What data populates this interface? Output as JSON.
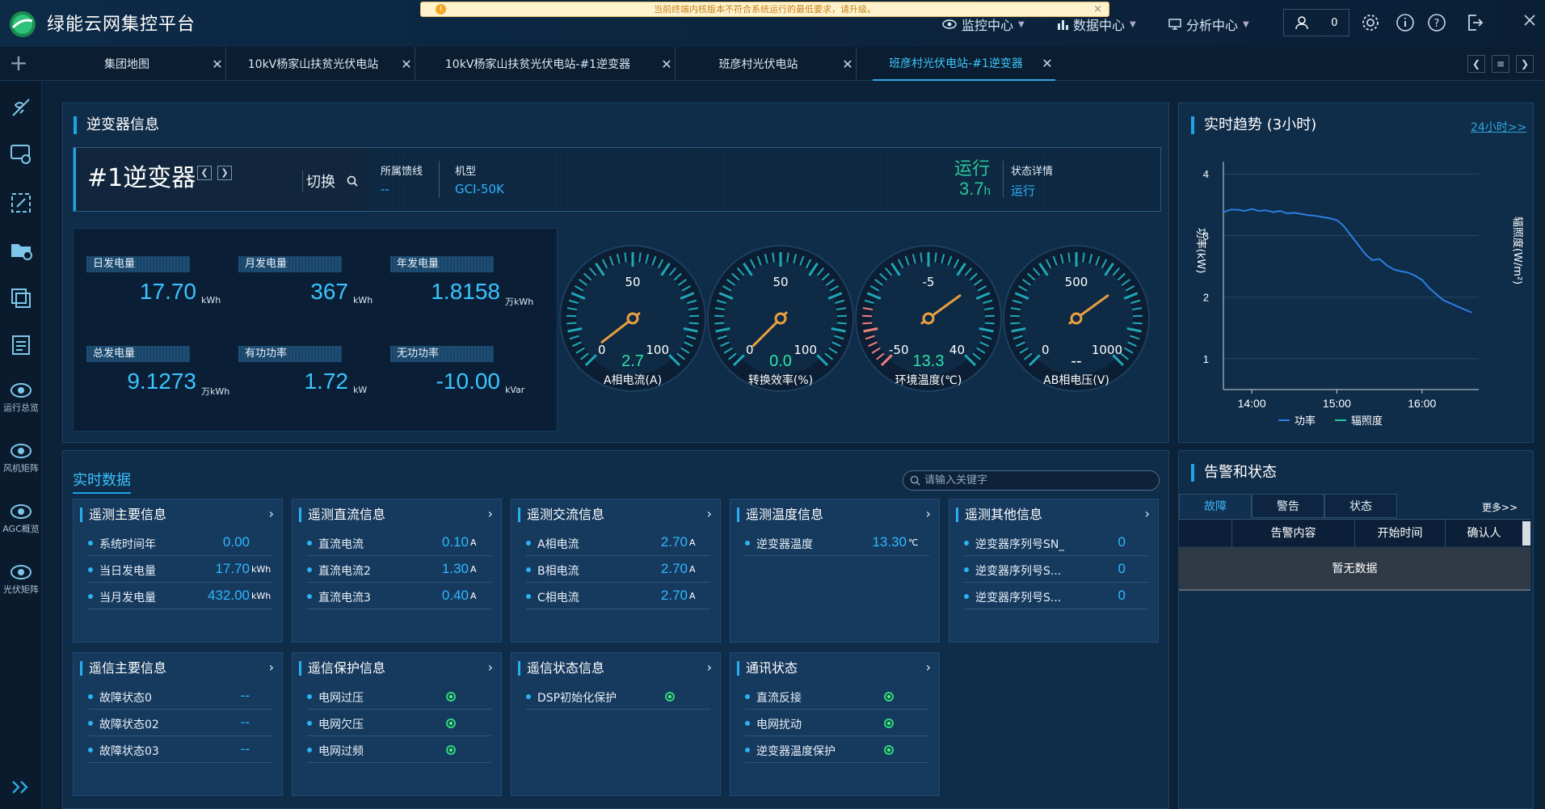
{
  "app": {
    "title": "绿能云网集控平台"
  },
  "notice": {
    "text": "当前终端内核版本不符合系统运行的最低要求，请升级。"
  },
  "topnav": [
    {
      "label": "监控中心",
      "icon": "eye-icon"
    },
    {
      "label": "数据中心",
      "icon": "bar-chart-icon"
    },
    {
      "label": "分析中心",
      "icon": "monitor-chart-icon"
    }
  ],
  "user": {
    "count": "0"
  },
  "tabs": [
    {
      "label": "集团地图"
    },
    {
      "label": "10kV杨家山扶贫光伏电站"
    },
    {
      "label": "10kV杨家山扶贫光伏电站-#1逆变器"
    },
    {
      "label": "班彦村光伏电站"
    },
    {
      "label": "班彦村光伏电站-#1逆变器"
    }
  ],
  "sidebar": [
    {
      "icon": "satellite-icon",
      "label": ""
    },
    {
      "icon": "monitor-refresh-icon",
      "label": ""
    },
    {
      "icon": "edit-frame-icon",
      "label": ""
    },
    {
      "icon": "folder-add-icon",
      "label": ""
    },
    {
      "icon": "layers-icon",
      "label": ""
    },
    {
      "icon": "list-doc-icon",
      "label": ""
    },
    {
      "icon": "eye-icon",
      "label": "运行总览"
    },
    {
      "icon": "eye-icon",
      "label": "风机矩阵"
    },
    {
      "icon": "eye-icon",
      "label": "AGC概览"
    },
    {
      "icon": "eye-icon",
      "label": "光伏矩阵"
    }
  ],
  "inverter": {
    "section_title": "逆变器信息",
    "name": "#1逆变器",
    "switch_label": "切换",
    "feeder_label": "所属馈线",
    "feeder_value": "--",
    "model_label": "机型",
    "model_value": "GCI-50K",
    "run_state": "运行",
    "run_hours_value": "3.7",
    "run_hours_unit": "h",
    "status_label": "状态详情",
    "status_value": "运行"
  },
  "stats": [
    {
      "label": "日发电量",
      "value": "17.70",
      "unit": "kWh"
    },
    {
      "label": "月发电量",
      "value": "367",
      "unit": "kWh"
    },
    {
      "label": "年发电量",
      "value": "1.8158",
      "unit": "万kWh"
    },
    {
      "label": "总发电量",
      "value": "9.1273",
      "unit": "万kWh"
    },
    {
      "label": "有功功率",
      "value": "1.72",
      "unit": "kW"
    },
    {
      "label": "无功功率",
      "value": "-10.00",
      "unit": "kVar"
    }
  ],
  "gauges": [
    {
      "name": "A相电流(A)",
      "min": "0",
      "max": "100",
      "mid": "50",
      "value": "2.7",
      "fraction": 0.027,
      "warn": false
    },
    {
      "name": "转换效率(%)",
      "min": "0",
      "max": "100",
      "mid": "50",
      "value": "0.0",
      "fraction": 0.0,
      "warn": false
    },
    {
      "name": "环境温度(℃)",
      "min": "-50",
      "max": "40",
      "mid": "-5",
      "value": "13.3",
      "fraction": 0.7,
      "warn": true
    },
    {
      "name": "AB相电压(V)",
      "min": "0",
      "max": "1000",
      "mid": "500",
      "value": "--",
      "fraction": 0.7,
      "warn": false
    }
  ],
  "trend": {
    "title": "实时趋势 (3小时)",
    "link": "24小时>>",
    "y_left_label": "功率(kW)",
    "y_right_label": "辐照度(W/m²)",
    "legend_power": "功率",
    "legend_irr": "辐照度",
    "colors": {
      "power": "#2b7fe0",
      "irr": "#22c9a0"
    }
  },
  "chart_data": {
    "type": "line",
    "title": "实时趋势 (3小时)",
    "xlabel": "",
    "ylabel": "功率(kW)",
    "y2label": "辐照度(W/m²)",
    "x_ticks": [
      "14:00",
      "15:00",
      "16:00"
    ],
    "y_ticks": [
      1,
      2,
      3,
      4
    ],
    "ylim": [
      0.5,
      4.2
    ],
    "xlim": [
      "13:40",
      "16:40"
    ],
    "series": [
      {
        "name": "功率",
        "x": [
          "13:40",
          "13:45",
          "13:50",
          "13:55",
          "14:00",
          "14:05",
          "14:10",
          "14:15",
          "14:20",
          "14:25",
          "14:30",
          "14:35",
          "14:40",
          "14:45",
          "14:50",
          "14:55",
          "15:00",
          "15:05",
          "15:10",
          "15:15",
          "15:20",
          "15:25",
          "15:30",
          "15:35",
          "15:40",
          "15:45",
          "15:50",
          "15:55",
          "16:00",
          "16:05",
          "16:10",
          "16:15",
          "16:20",
          "16:25",
          "16:30",
          "16:35"
        ],
        "values": [
          3.38,
          3.42,
          3.42,
          3.4,
          3.43,
          3.4,
          3.41,
          3.38,
          3.4,
          3.36,
          3.37,
          3.35,
          3.33,
          3.32,
          3.3,
          3.28,
          3.25,
          3.15,
          3.0,
          2.85,
          2.7,
          2.6,
          2.62,
          2.52,
          2.45,
          2.42,
          2.4,
          2.35,
          2.28,
          2.15,
          2.05,
          1.95,
          1.9,
          1.85,
          1.8,
          1.75
        ]
      },
      {
        "name": "辐照度",
        "x": [],
        "values": []
      }
    ],
    "legend": "bottom"
  },
  "realtime": {
    "title": "实时数据",
    "search_placeholder": "请输入关键字",
    "cards": [
      {
        "title": "遥测主要信息",
        "rows": [
          {
            "key": "系统时间年",
            "value": "0.00",
            "unit": ""
          },
          {
            "key": "当日发电量",
            "value": "17.70",
            "unit": "kWh"
          },
          {
            "key": "当月发电量",
            "value": "432.00",
            "unit": "kWh"
          }
        ]
      },
      {
        "title": "遥测直流信息",
        "rows": [
          {
            "key": "直流电流",
            "value": "0.10",
            "unit": "A"
          },
          {
            "key": "直流电流2",
            "value": "1.30",
            "unit": "A"
          },
          {
            "key": "直流电流3",
            "value": "0.40",
            "unit": "A"
          }
        ]
      },
      {
        "title": "遥测交流信息",
        "rows": [
          {
            "key": "A相电流",
            "value": "2.70",
            "unit": "A"
          },
          {
            "key": "B相电流",
            "value": "2.70",
            "unit": "A"
          },
          {
            "key": "C相电流",
            "value": "2.70",
            "unit": "A"
          }
        ]
      },
      {
        "title": "遥测温度信息",
        "rows": [
          {
            "key": "逆变器温度",
            "value": "13.30",
            "unit": "℃"
          }
        ]
      },
      {
        "title": "遥测其他信息",
        "rows": [
          {
            "key": "逆变器序列号SN_",
            "value": "0",
            "unit": ""
          },
          {
            "key": "逆变器序列号S...",
            "value": "0",
            "unit": ""
          },
          {
            "key": "逆变器序列号S...",
            "value": "0",
            "unit": ""
          }
        ]
      },
      {
        "title": "遥信主要信息",
        "rows": [
          {
            "key": "故障状态0",
            "value": "--",
            "unit": ""
          },
          {
            "key": "故障状态02",
            "value": "--",
            "unit": ""
          },
          {
            "key": "故障状态03",
            "value": "--",
            "unit": ""
          }
        ]
      },
      {
        "title": "遥信保护信息",
        "rows": [
          {
            "key": "电网过压",
            "indicator": true
          },
          {
            "key": "电网欠压",
            "indicator": true
          },
          {
            "key": "电网过频",
            "indicator": true
          }
        ]
      },
      {
        "title": "遥信状态信息",
        "rows": [
          {
            "key": "DSP初始化保护",
            "indicator": true
          }
        ]
      },
      {
        "title": "通讯状态",
        "rows": [
          {
            "key": "直流反接",
            "indicator": true
          },
          {
            "key": "电网扰动",
            "indicator": true
          },
          {
            "key": "逆变器温度保护",
            "indicator": true
          }
        ]
      }
    ]
  },
  "alarm": {
    "title": "告警和状态",
    "tabs": [
      "故障",
      "警告",
      "状态"
    ],
    "more": "更多>>",
    "columns": [
      "",
      "告警内容",
      "开始时间",
      "确认人"
    ],
    "empty": "暂无数据"
  }
}
